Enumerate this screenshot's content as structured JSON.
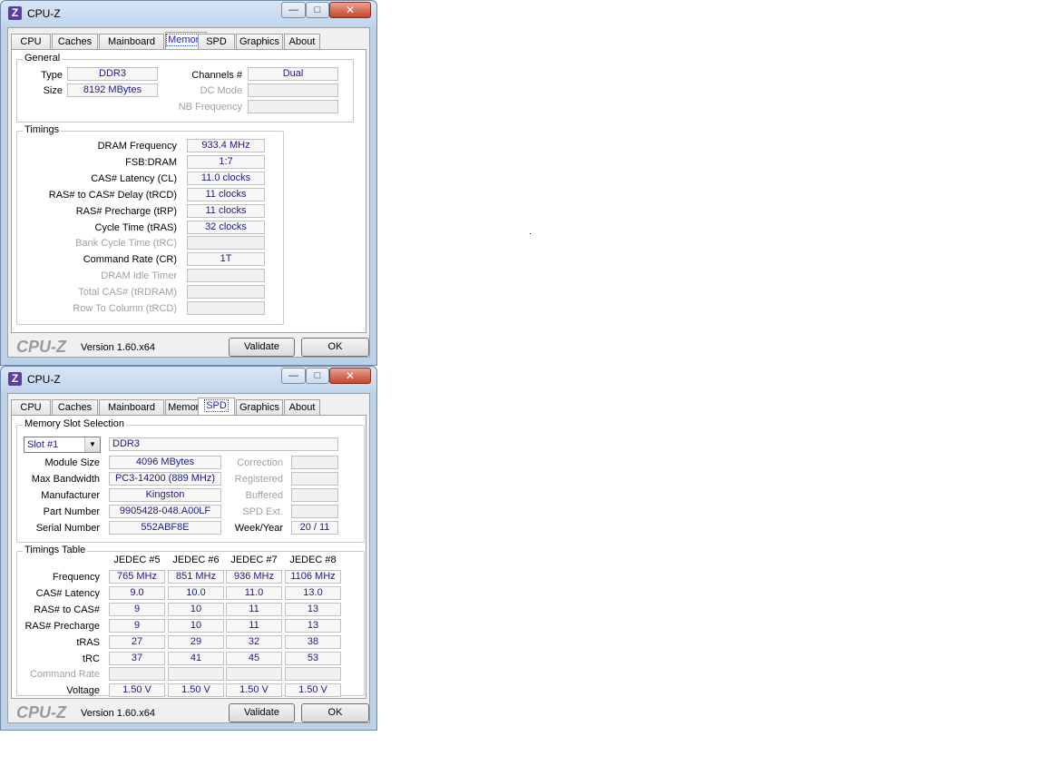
{
  "window1": {
    "title": "CPU-Z",
    "icon_letter": "Z",
    "tabs": [
      "CPU",
      "Caches",
      "Mainboard",
      "Memory",
      "SPD",
      "Graphics",
      "About"
    ],
    "active_tab": "Memory",
    "general": {
      "label": "General",
      "type_label": "Type",
      "type_value": "DDR3",
      "size_label": "Size",
      "size_value": "8192 MBytes",
      "channels_label": "Channels #",
      "channels_value": "Dual",
      "dcmode_label": "DC Mode",
      "dcmode_value": "",
      "nbfreq_label": "NB Frequency",
      "nbfreq_value": ""
    },
    "timings": {
      "label": "Timings",
      "rows": [
        {
          "label": "DRAM Frequency",
          "value": "933.4 MHz",
          "disabled": false
        },
        {
          "label": "FSB:DRAM",
          "value": "1:7",
          "disabled": false
        },
        {
          "label": "CAS# Latency (CL)",
          "value": "11.0 clocks",
          "disabled": false
        },
        {
          "label": "RAS# to CAS# Delay (tRCD)",
          "value": "11 clocks",
          "disabled": false
        },
        {
          "label": "RAS# Precharge (tRP)",
          "value": "11 clocks",
          "disabled": false
        },
        {
          "label": "Cycle Time (tRAS)",
          "value": "32 clocks",
          "disabled": false
        },
        {
          "label": "Bank Cycle Time (tRC)",
          "value": "",
          "disabled": true
        },
        {
          "label": "Command Rate (CR)",
          "value": "1T",
          "disabled": false
        },
        {
          "label": "DRAM Idle Timer",
          "value": "",
          "disabled": true
        },
        {
          "label": "Total CAS# (tRDRAM)",
          "value": "",
          "disabled": true
        },
        {
          "label": "Row To Column (tRCD)",
          "value": "",
          "disabled": true
        }
      ]
    },
    "footer": {
      "brand": "CPU-Z",
      "version": "Version 1.60.x64",
      "validate": "Validate",
      "ok": "OK"
    }
  },
  "window2": {
    "title": "CPU-Z",
    "icon_letter": "Z",
    "tabs": [
      "CPU",
      "Caches",
      "Mainboard",
      "Memory",
      "SPD",
      "Graphics",
      "About"
    ],
    "active_tab": "SPD",
    "slot": {
      "label": "Memory Slot Selection",
      "selected": "Slot #1",
      "type_value": "DDR3",
      "left_rows": [
        {
          "label": "Module Size",
          "value": "4096 MBytes"
        },
        {
          "label": "Max Bandwidth",
          "value": "PC3-14200 (889 MHz)"
        },
        {
          "label": "Manufacturer",
          "value": "Kingston"
        },
        {
          "label": "Part Number",
          "value": "9905428-048.A00LF"
        },
        {
          "label": "Serial Number",
          "value": "552ABF8E"
        }
      ],
      "right_rows": [
        {
          "label": "Correction",
          "value": "",
          "disabled": true
        },
        {
          "label": "Registered",
          "value": "",
          "disabled": true
        },
        {
          "label": "Buffered",
          "value": "",
          "disabled": true
        },
        {
          "label": "SPD Ext.",
          "value": "",
          "disabled": true
        },
        {
          "label": "Week/Year",
          "value": "20 / 11",
          "disabled": false
        }
      ]
    },
    "timings_table": {
      "label": "Timings Table",
      "columns": [
        "JEDEC #5",
        "JEDEC #6",
        "JEDEC #7",
        "JEDEC #8"
      ],
      "rows": [
        {
          "label": "Frequency",
          "values": [
            "765 MHz",
            "851 MHz",
            "936 MHz",
            "1106 MHz"
          ],
          "disabled": false
        },
        {
          "label": "CAS# Latency",
          "values": [
            "9.0",
            "10.0",
            "11.0",
            "13.0"
          ],
          "disabled": false
        },
        {
          "label": "RAS# to CAS#",
          "values": [
            "9",
            "10",
            "11",
            "13"
          ],
          "disabled": false
        },
        {
          "label": "RAS# Precharge",
          "values": [
            "9",
            "10",
            "11",
            "13"
          ],
          "disabled": false
        },
        {
          "label": "tRAS",
          "values": [
            "27",
            "29",
            "32",
            "38"
          ],
          "disabled": false
        },
        {
          "label": "tRC",
          "values": [
            "37",
            "41",
            "45",
            "53"
          ],
          "disabled": false
        },
        {
          "label": "Command Rate",
          "values": [
            "",
            "",
            "",
            ""
          ],
          "disabled": true
        },
        {
          "label": "Voltage",
          "values": [
            "1.50 V",
            "1.50 V",
            "1.50 V",
            "1.50 V"
          ],
          "disabled": false
        }
      ]
    },
    "footer": {
      "brand": "CPU-Z",
      "version": "Version 1.60.x64",
      "validate": "Validate",
      "ok": "OK"
    }
  },
  "icons": {
    "minimize": "minimize-icon",
    "maximize": "maximize-icon",
    "close": "close-icon",
    "dropdown": "chevron-down-icon"
  }
}
